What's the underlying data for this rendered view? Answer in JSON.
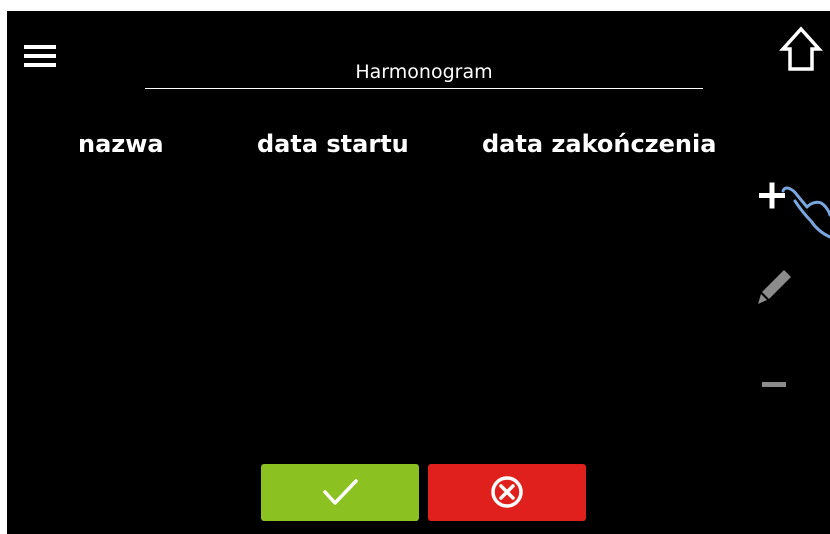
{
  "header": {
    "title": "Harmonogram"
  },
  "table": {
    "columns": [
      "nazwa",
      "data startu",
      "data zakończenia"
    ],
    "rows": []
  },
  "sidebar": {
    "actions": [
      {
        "name": "add",
        "icon": "plus-icon",
        "state": "active"
      },
      {
        "name": "edit",
        "icon": "pencil-icon",
        "state": "disabled"
      },
      {
        "name": "remove",
        "icon": "minus-icon",
        "state": "disabled"
      }
    ]
  },
  "footer": {
    "confirm_icon": "checkmark-icon",
    "cancel_icon": "circle-x-icon"
  },
  "colors": {
    "background": "#000000",
    "confirm": "#8bc120",
    "cancel": "#e0201c",
    "disabled": "#8c8c8c",
    "hand_outline": "#7aa6e0"
  }
}
